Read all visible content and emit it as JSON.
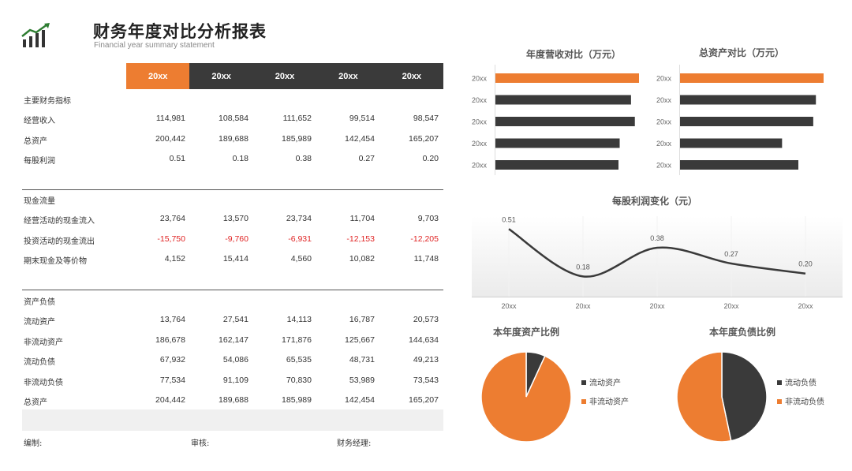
{
  "header": {
    "title": "财务年度对比分析报表",
    "subtitle": "Financial year summary statement"
  },
  "table": {
    "years": [
      "20xx",
      "20xx",
      "20xx",
      "20xx",
      "20xx"
    ],
    "sections": [
      {
        "label": "主要财务指标",
        "rows": [
          {
            "label": "经营收入",
            "values": [
              "114,981",
              "108,584",
              "111,652",
              "99,514",
              "98,547"
            ]
          },
          {
            "label": "总资产",
            "values": [
              "200,442",
              "189,688",
              "185,989",
              "142,454",
              "165,207"
            ]
          },
          {
            "label": "每股利润",
            "values": [
              "0.51",
              "0.18",
              "0.38",
              "0.27",
              "0.20"
            ]
          }
        ]
      },
      {
        "label": "现金流量",
        "rows": [
          {
            "label": "经营活动的现金流入",
            "values": [
              "23,764",
              "13,570",
              "23,734",
              "11,704",
              "9,703"
            ]
          },
          {
            "label": "投资活动的现金流出",
            "values": [
              "-15,750",
              "-9,760",
              "-6,931",
              "-12,153",
              "-12,205"
            ],
            "negative": true
          },
          {
            "label": "期末现金及等价物",
            "values": [
              "4,152",
              "15,414",
              "4,560",
              "10,082",
              "11,748"
            ]
          }
        ]
      },
      {
        "label": "资产负债",
        "rows": [
          {
            "label": "流动资产",
            "values": [
              "13,764",
              "27,541",
              "14,113",
              "16,787",
              "20,573"
            ]
          },
          {
            "label": "非流动资产",
            "values": [
              "186,678",
              "162,147",
              "171,876",
              "125,667",
              "144,634"
            ]
          },
          {
            "label": "流动负债",
            "values": [
              "67,932",
              "54,086",
              "65,535",
              "48,731",
              "49,213"
            ]
          },
          {
            "label": "非流动负债",
            "values": [
              "77,534",
              "91,109",
              "70,830",
              "53,989",
              "73,543"
            ]
          },
          {
            "label": "总资产",
            "values": [
              "204,442",
              "189,688",
              "185,989",
              "142,454",
              "165,207"
            ]
          }
        ]
      }
    ]
  },
  "footer": {
    "editor": "编制:",
    "reviewer": "审核:",
    "manager": "财务经理:"
  },
  "colors": {
    "accent": "#ed7d31",
    "dark": "#3a3a3a"
  },
  "chart_data": [
    {
      "type": "bar",
      "title": "年度营收对比（万元）",
      "orientation": "horizontal",
      "categories": [
        "20xx",
        "20xx",
        "20xx",
        "20xx",
        "20xx"
      ],
      "values": [
        114981,
        108584,
        111652,
        99514,
        98547
      ],
      "highlight_index": 0
    },
    {
      "type": "bar",
      "title": "总资产对比（万元）",
      "orientation": "horizontal",
      "categories": [
        "20xx",
        "20xx",
        "20xx",
        "20xx",
        "20xx"
      ],
      "values": [
        200442,
        189688,
        185989,
        142454,
        165207
      ],
      "highlight_index": 0
    },
    {
      "type": "line",
      "title": "每股利润变化（元）",
      "categories": [
        "20xx",
        "20xx",
        "20xx",
        "20xx",
        "20xx"
      ],
      "values": [
        0.51,
        0.18,
        0.38,
        0.27,
        0.2
      ],
      "data_labels": [
        "0.51",
        "0.18",
        "0.38",
        "0.27",
        "0.20"
      ],
      "smooth": true
    },
    {
      "type": "pie",
      "title": "本年度资产比例",
      "labels": [
        "流动资产",
        "非流动资产"
      ],
      "values": [
        13764,
        186678
      ],
      "colors": [
        "#3a3a3a",
        "#ed7d31"
      ],
      "legend": "right"
    },
    {
      "type": "pie",
      "title": "本年度负债比例",
      "labels": [
        "流动负债",
        "非流动负债"
      ],
      "values": [
        67932,
        77534
      ],
      "colors": [
        "#3a3a3a",
        "#ed7d31"
      ],
      "legend": "right"
    }
  ]
}
